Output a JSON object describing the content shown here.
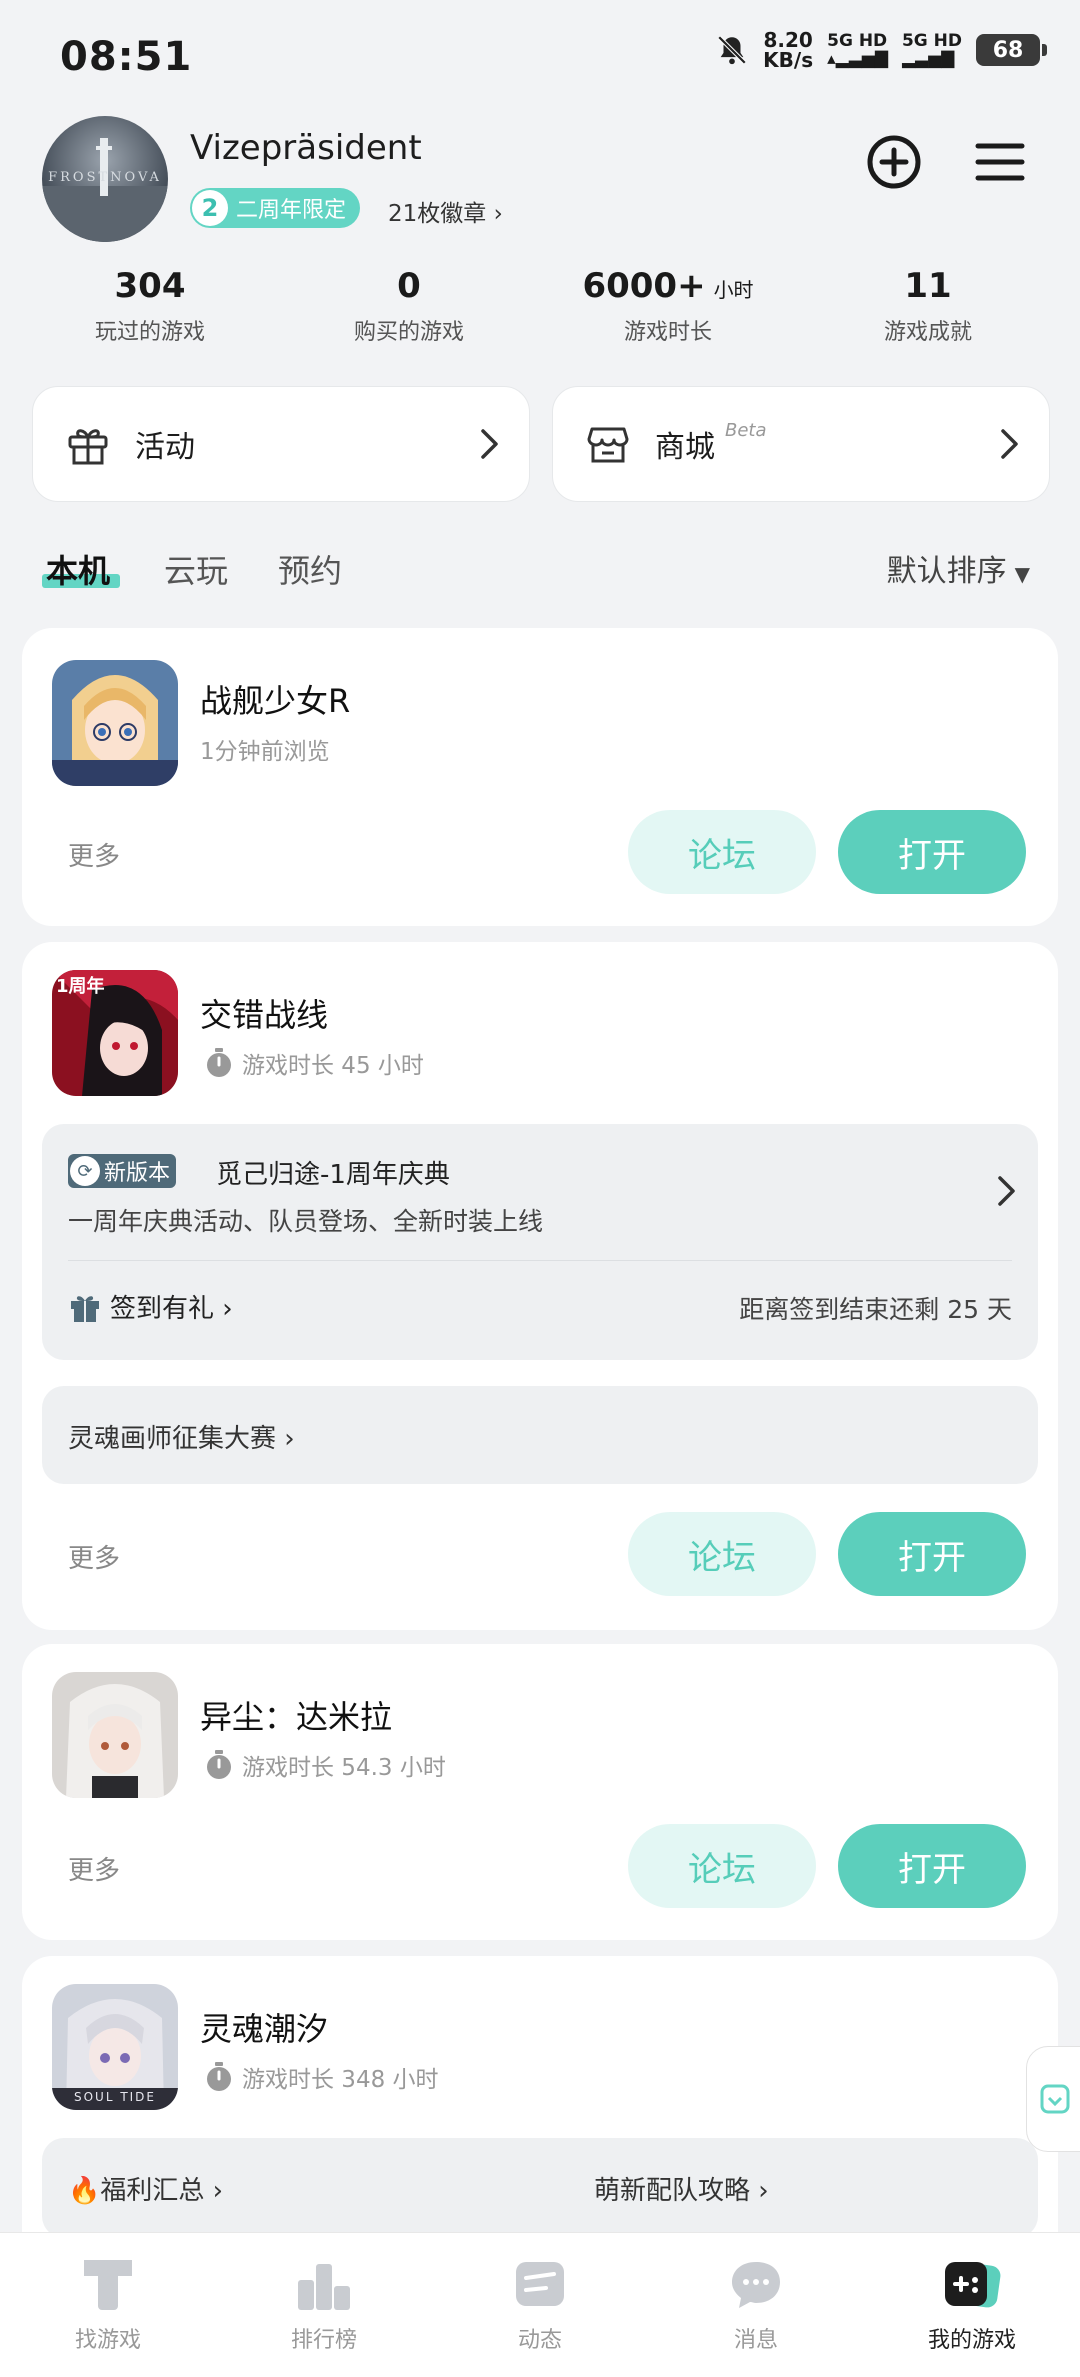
{
  "status_bar": {
    "time": "08:51",
    "speed_value": "8.20",
    "speed_unit": "KB/s",
    "signal1": "5G HD",
    "signal2": "5G HD",
    "battery": "68"
  },
  "profile": {
    "username": "Vizepräsident",
    "avatar_text": "FROSTNOVA",
    "badge_number": "2",
    "badge_label": "二周年限定",
    "medals": "21枚徽章 ›"
  },
  "stats": [
    {
      "value": "304",
      "unit": "",
      "label": "玩过的游戏"
    },
    {
      "value": "0",
      "unit": "",
      "label": "购买的游戏"
    },
    {
      "value": "6000+",
      "unit": "小时",
      "label": "游戏时长"
    },
    {
      "value": "11",
      "unit": "",
      "label": "游戏成就"
    }
  ],
  "quick_cards": {
    "activity": "活动",
    "store": "商城",
    "beta": "Beta"
  },
  "tabs": {
    "local": "本机",
    "cloud": "云玩",
    "reserve": "预约",
    "sort": "默认排序"
  },
  "buttons": {
    "more": "更多",
    "forum": "论坛",
    "open": "打开"
  },
  "games": [
    {
      "name": "战舰少女R",
      "sub": "1分钟前浏览"
    },
    {
      "name": "交错战线",
      "sub": "游戏时长 45 小时",
      "update_tag": "新版本",
      "update_title": "觅己归途-1周年庆典",
      "update_desc": "一周年庆典活动、队员登场、全新时装上线",
      "checkin": "签到有礼 ›",
      "checkin_remain": "距离签到结束还剩 25 天",
      "contest": "灵魂画师征集大赛 ›",
      "icon_text": "1周年"
    },
    {
      "name": "异尘：达米拉",
      "sub": "游戏时长 54.3 小时"
    },
    {
      "name": "灵魂潮汐",
      "sub": "游戏时长 348 小时",
      "welfare": "🔥福利汇总 ›",
      "guide": "萌新配队攻略 ›",
      "icon_text": "SOUL TIDE"
    }
  ],
  "bottom_nav": [
    "找游戏",
    "排行榜",
    "动态",
    "消息",
    "我的游戏"
  ],
  "colors": {
    "accent": "#5ccfbc",
    "accent_light": "#e3f7f4",
    "background": "#f2f3f5"
  }
}
